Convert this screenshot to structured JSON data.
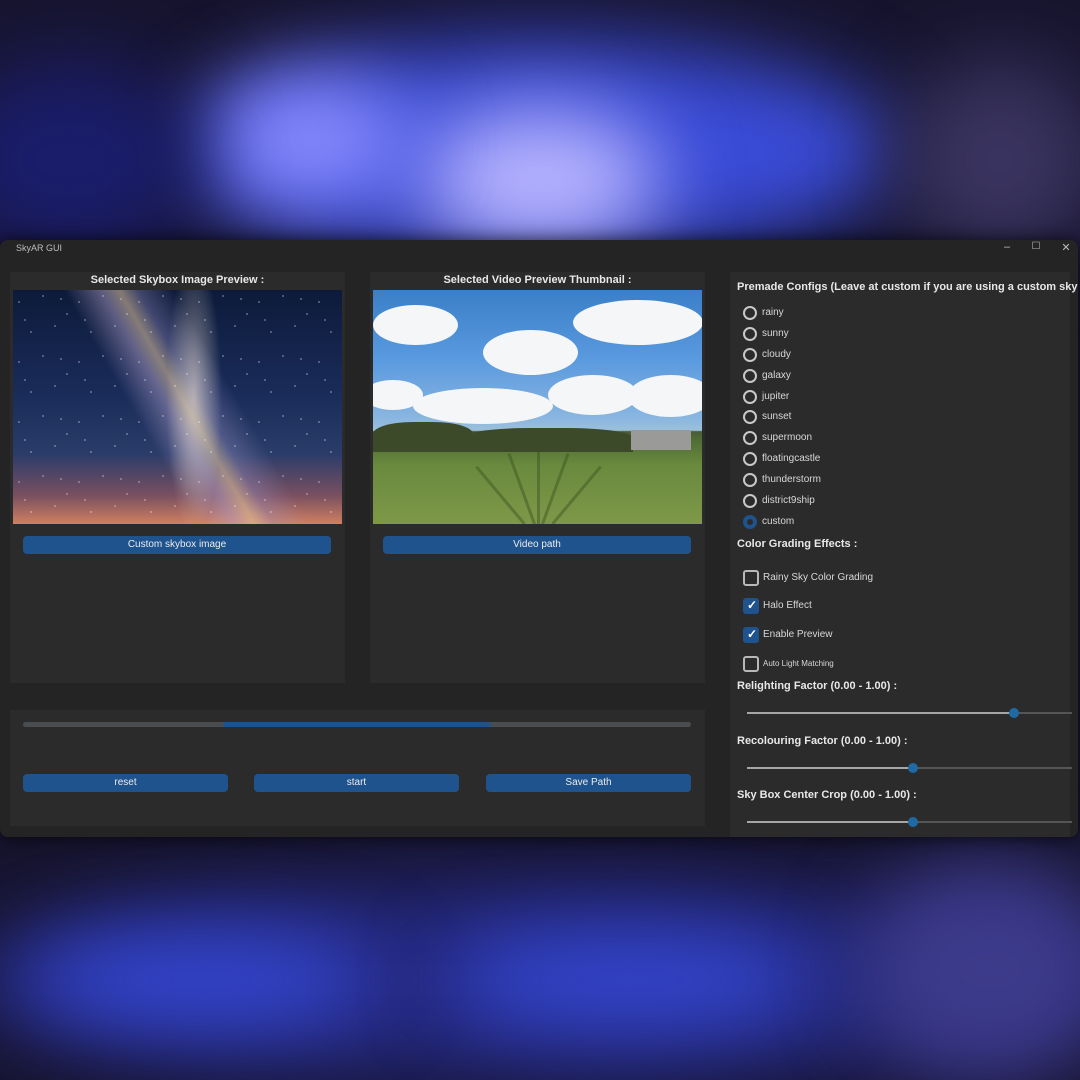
{
  "window": {
    "title": "SkyAR GUI",
    "min_glyph": "–",
    "max_glyph": "☐",
    "close_glyph": "✕"
  },
  "skybox_panel": {
    "title": "Selected Skybox Image Preview :",
    "button": "Custom skybox image"
  },
  "video_panel": {
    "title": "Selected Video Preview Thumbnail :",
    "button": "Video path"
  },
  "progress": {
    "start_fraction": 0.3,
    "end_fraction": 0.7
  },
  "actions": {
    "reset": "reset",
    "start": "start",
    "save": "Save Path"
  },
  "configs": {
    "title": "Premade Configs (Leave at custom if you are using a custom skybo",
    "options": [
      "rainy",
      "sunny",
      "cloudy",
      "galaxy",
      "jupiter",
      "sunset",
      "supermoon",
      "floatingcastle",
      "thunderstorm",
      "district9ship",
      "custom"
    ],
    "selected": "custom"
  },
  "color_grading": {
    "title": "Color Grading Effects :",
    "items": [
      {
        "label": "Rainy Sky Color Grading",
        "checked": false
      },
      {
        "label": "Halo Effect",
        "checked": true
      },
      {
        "label": "Enable Preview",
        "checked": true
      },
      {
        "label": "Auto Light Matching",
        "checked": false
      }
    ]
  },
  "sliders": [
    {
      "label": "Relighting Factor (0.00 - 1.00) :",
      "value": 0.82
    },
    {
      "label": "Recolouring Factor (0.00 - 1.00) :",
      "value": 0.51
    },
    {
      "label": "Sky Box Center Crop (0.00 - 1.00) :",
      "value": 0.51
    }
  ],
  "colors": {
    "accent": "#1f538d",
    "panel": "#2b2b2b",
    "window": "#242424",
    "text": "#e8e8e8"
  }
}
